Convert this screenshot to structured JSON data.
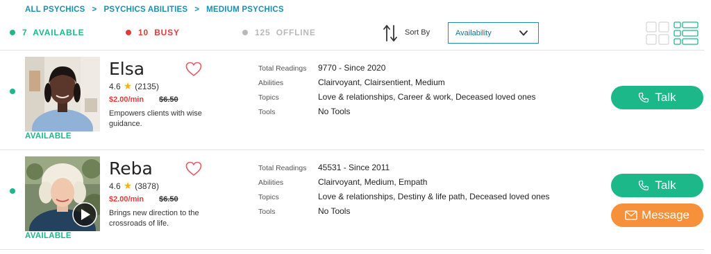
{
  "breadcrumb": [
    {
      "label": "ALL PSYCHICS"
    },
    {
      "label": "PSYCHICS ABILITIES"
    },
    {
      "label": "MEDIUM PSYCHICS"
    }
  ],
  "breadcrumb_separator": ">",
  "status": {
    "available": "7  AVAILABLE",
    "busy": "10  BUSY",
    "offline": "125  OFFLINE"
  },
  "sort": {
    "label": "Sort By",
    "selected": "Availability"
  },
  "colors": {
    "available": "#1cb88a",
    "busy": "#e23a3a",
    "offline": "#b9b9b9",
    "link": "#1a8fb0",
    "message_button": "#f7903a"
  },
  "details_labels": {
    "readings": "Total Readings",
    "abilities": "Abilities",
    "topics": "Topics",
    "tools": "Tools"
  },
  "psychics": [
    {
      "name": "Elsa",
      "rating": "4.6",
      "reviews": "(2135)",
      "price": "$2.00/min",
      "old_price": "$6.50",
      "description": "Empowers clients with wise guidance.",
      "availability": "AVAILABLE",
      "total_readings": "9770 - Since 2020",
      "abilities": "Clairvoyant, Clairsentient, Medium",
      "topics": "Love & relationships, Career & work, Deceased loved ones",
      "tools": "No Tools",
      "talk_label": "Talk"
    },
    {
      "name": "Reba",
      "rating": "4.6",
      "reviews": "(3878)",
      "price": "$2.00/min",
      "old_price": "$6.50",
      "description": "Brings new direction to the crossroads of life.",
      "availability": "AVAILABLE",
      "total_readings": "45531 - Since 2011",
      "abilities": "Clairvoyant, Medium, Empath",
      "topics": "Love & relationships, Destiny & life path, Deceased loved ones",
      "tools": "No Tools",
      "talk_label": "Talk",
      "message_label": "Message"
    }
  ]
}
